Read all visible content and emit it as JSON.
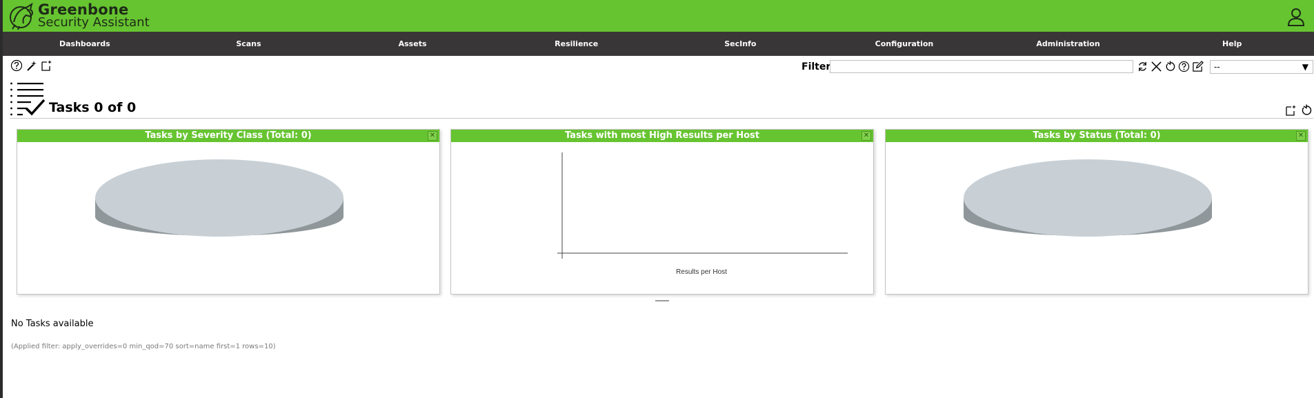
{
  "app": {
    "brand_title": "Greenbone",
    "brand_subtitle": "Security Assistant"
  },
  "nav": {
    "items": [
      "Dashboards",
      "Scans",
      "Assets",
      "Resilience",
      "SecInfo",
      "Configuration",
      "Administration",
      "Help"
    ]
  },
  "filter": {
    "label": "Filter",
    "value": "",
    "selected_option": "--"
  },
  "page": {
    "title": "Tasks 0 of 0"
  },
  "dashboard": {
    "panels": [
      {
        "title": "Tasks by Severity Class (Total: 0)"
      },
      {
        "title": "Tasks with most High Results per Host",
        "xlabel": "Results per Host"
      },
      {
        "title": "Tasks by Status (Total: 0)"
      }
    ]
  },
  "chart_data": [
    {
      "type": "pie",
      "title": "Tasks by Severity Class (Total: 0)",
      "values": [],
      "empty_color": "#c8d0d6"
    },
    {
      "type": "bar",
      "title": "Tasks with most High Results per Host",
      "xlabel": "Results per Host",
      "values": []
    },
    {
      "type": "pie",
      "title": "Tasks by Status (Total: 0)",
      "values": [],
      "empty_color": "#c8d0d6"
    }
  ],
  "content": {
    "empty_message": "No Tasks available",
    "applied_filter": "(Applied filter: apply_overrides=0 min_qod=70 sort=name first=1 rows=10)"
  },
  "colors": {
    "brand_green": "#66c430",
    "nav_bg": "#393637"
  }
}
